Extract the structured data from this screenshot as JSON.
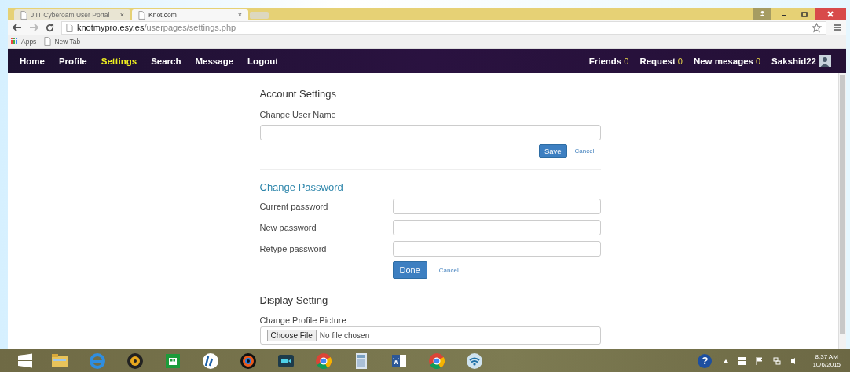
{
  "browser": {
    "tabs": [
      {
        "label": "JIIT Cyberoam User Portal",
        "close": "×",
        "selected": false
      },
      {
        "label": "Knot.com",
        "close": "×",
        "selected": true
      }
    ],
    "url": {
      "host": "knotmypro.esy.es",
      "path": "/userpages/settings.php"
    },
    "bookmarks": [
      "Apps",
      "New Tab"
    ]
  },
  "nav": {
    "items": [
      {
        "label": "Home",
        "selected": false
      },
      {
        "label": "Profile",
        "selected": false
      },
      {
        "label": "Settings",
        "selected": true
      },
      {
        "label": "Search",
        "selected": false
      },
      {
        "label": "Message",
        "selected": false
      },
      {
        "label": "Logout",
        "selected": false
      }
    ],
    "counters": [
      {
        "label": "Friends",
        "count": "0"
      },
      {
        "label": "Request",
        "count": "0"
      },
      {
        "label": "New mesages",
        "count": "0"
      }
    ],
    "user": "Sakshid22"
  },
  "account": {
    "title": "Account Settings",
    "label": "Change User Name",
    "save": "Save",
    "cancel": "Cancel"
  },
  "password": {
    "title": "Change Password",
    "fields": [
      {
        "label": "Current password"
      },
      {
        "label": "New password"
      },
      {
        "label": "Retype password"
      }
    ],
    "done": "Done",
    "cancel": "Cancel"
  },
  "display": {
    "title": "Display Setting",
    "label": "Change Profile Picture",
    "choose": "Choose File",
    "status": "No file chosen"
  },
  "taskbar": {
    "help": "?",
    "time": "8:37 AM",
    "date": "10/6/2015"
  }
}
